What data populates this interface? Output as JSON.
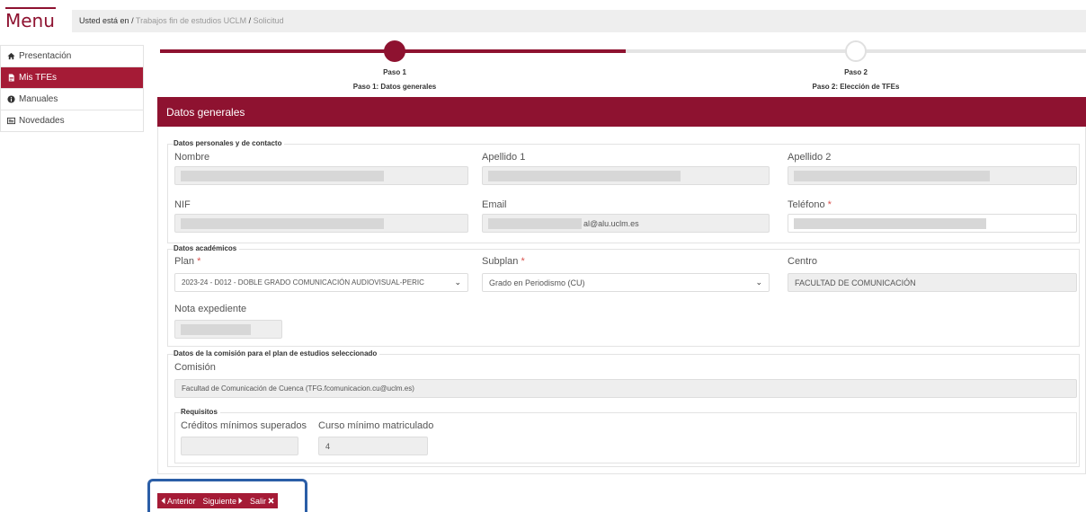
{
  "header": {
    "menu_label": "Menu",
    "breadcrumb": {
      "prefix": "Usted está en",
      "items": [
        "Trabajos fin de estudios UCLM",
        "Solicitud"
      ]
    }
  },
  "sidebar": {
    "items": [
      {
        "label": "Presentación",
        "icon": "home-icon"
      },
      {
        "label": "Mis TFEs",
        "icon": "document-icon",
        "active": true
      },
      {
        "label": "Manuales",
        "icon": "info-icon"
      },
      {
        "label": "Novedades",
        "icon": "news-icon"
      }
    ]
  },
  "stepper": {
    "steps": [
      {
        "title": "Paso 1",
        "subtitle": "Paso 1: Datos generales",
        "done": true
      },
      {
        "title": "Paso 2",
        "subtitle": "Paso 2: Elección de TFEs",
        "done": false
      }
    ]
  },
  "panel": {
    "title": "Datos generales",
    "personal": {
      "legend": "Datos personales y de contacto",
      "nombre_label": "Nombre",
      "apellido1_label": "Apellido 1",
      "apellido2_label": "Apellido 2",
      "nif_label": "NIF",
      "email_label": "Email",
      "email_value": "al@alu.uclm.es",
      "telefono_label": "Teléfono",
      "required_mark": "*"
    },
    "academic": {
      "legend": "Datos académicos",
      "plan_label": "Plan",
      "plan_value": "2023-24 - D012 - DOBLE GRADO COMUNICACIÓN AUDIOVISUAL-PERIC",
      "subplan_label": "Subplan",
      "subplan_value": "Grado en Periodismo (CU)",
      "centro_label": "Centro",
      "centro_value": "FACULTAD DE COMUNICACIÓN",
      "nota_label": "Nota expediente"
    },
    "commission": {
      "legend": "Datos de la comisión para el plan de estudios seleccionado",
      "comision_label": "Comisión",
      "comision_value": "Facultad de Comunicación de Cuenca (TFG.fcomunicacion.cu@uclm.es)",
      "requisitos_legend": "Requisitos",
      "creditos_label": "Créditos mínimos superados",
      "curso_label": "Curso mínimo matriculado",
      "curso_value": "4"
    }
  },
  "actions": {
    "prev_label": "Anterior",
    "next_label": "Siguiente",
    "exit_label": "Salir"
  },
  "colors": {
    "accent": "#8e1230",
    "highlight_frame": "#2b5ea7"
  }
}
